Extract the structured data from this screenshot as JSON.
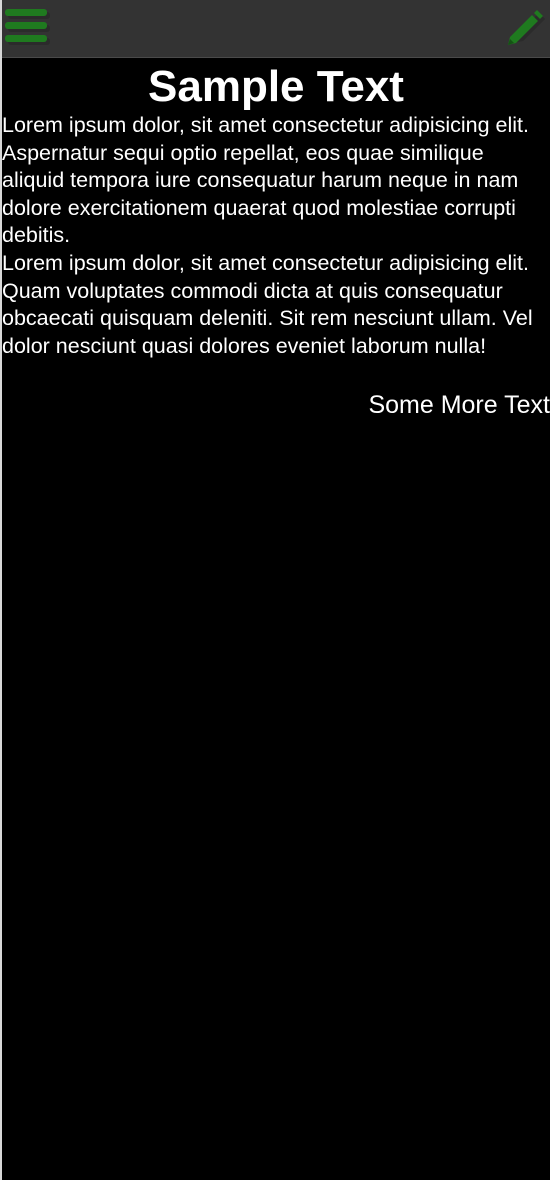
{
  "toolbar": {
    "menu_icon": "hamburger-menu-icon",
    "edit_icon": "pencil-icon",
    "icon_color": "#1f7a1f",
    "bar_color": "#333333"
  },
  "content": {
    "title": "Sample Text",
    "paragraph_1": "Lorem ipsum dolor, sit amet consectetur adipisicing elit. Aspernatur sequi optio repellat, eos quae similique aliquid tempora iure consequatur harum neque in nam dolore exercitationem quaerat quod molestiae corrupti debitis.",
    "paragraph_2": "Lorem ipsum dolor, sit amet consectetur adipisicing elit. Quam voluptates commodi dicta at quis consequatur obcaecati quisquam deleniti. Sit rem nesciunt ullam. Vel dolor nesciunt quasi dolores eveniet laborum nulla!",
    "more_text": "Some More Text"
  }
}
